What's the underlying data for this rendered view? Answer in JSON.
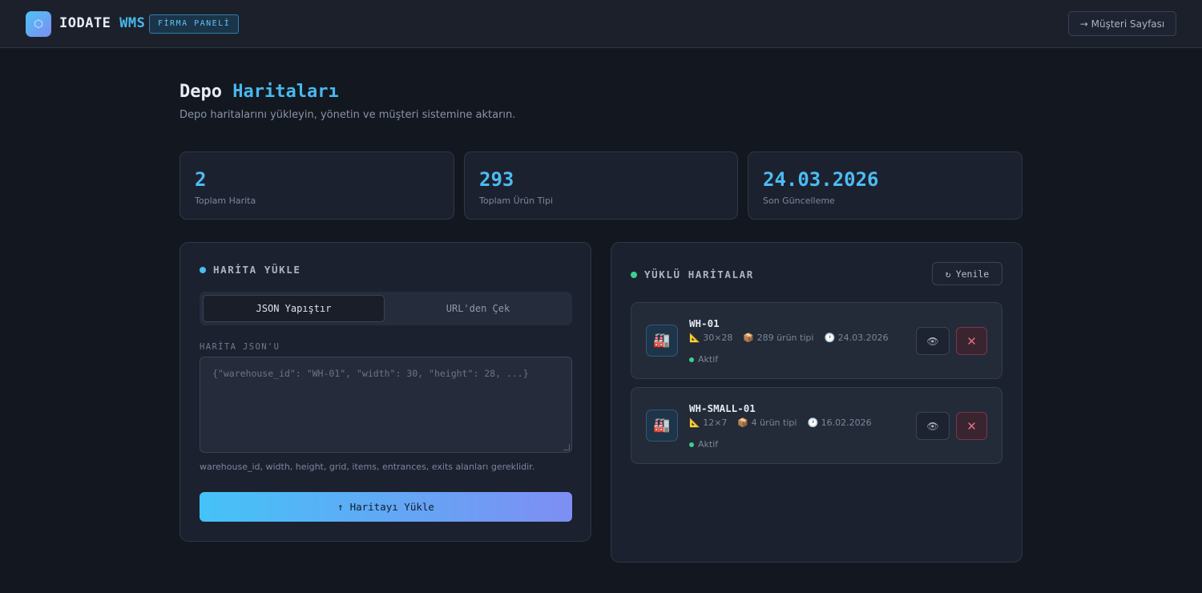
{
  "header": {
    "logo_icon": "hexagon-icon",
    "brand_main": "IODATE",
    "brand_accent": "WMS",
    "panel_badge": "FİRMA PANELİ",
    "customer_page": "→ Müşteri Sayfası"
  },
  "page": {
    "title_main": "Depo",
    "title_accent": "Haritaları",
    "subtitle": "Depo haritalarını yükleyin, yönetin ve müşteri sistemine aktarın."
  },
  "stats": [
    {
      "value": "2",
      "label": "Toplam Harita"
    },
    {
      "value": "293",
      "label": "Toplam Ürün Tipi"
    },
    {
      "value": "24.03.2026",
      "label": "Son Güncelleme"
    }
  ],
  "upload": {
    "heading": "HARİTA YÜKLE",
    "tabs": [
      {
        "label": "JSON Yapıştır"
      },
      {
        "label": "URL'den Çek"
      }
    ],
    "field_label": "HARİTA JSON'U",
    "placeholder": "{\"warehouse_id\": \"WH-01\", \"width\": 30, \"height\": 28, ...}",
    "hint": "warehouse_id, width, height, grid, items, entrances, exits alanları gereklidir.",
    "button_icon": "↑",
    "button_label": "Haritayı Yükle"
  },
  "loaded": {
    "heading": "YÜKLÜ HARİTALAR",
    "refresh_icon": "↻",
    "refresh_label": "Yenile",
    "maps": [
      {
        "name": "WH-01",
        "size": "📐 30×28",
        "items": "📦 289 ürün tipi",
        "date": "🕐 24.03.2026",
        "status": "Aktif"
      },
      {
        "name": "WH-SMALL-01",
        "size": "📐 12×7",
        "items": "📦 4 ürün tipi",
        "date": "🕐 16.02.2026",
        "status": "Aktif"
      }
    ],
    "map_icon": "🏭",
    "view_icon": "👁",
    "delete_icon": "✕"
  },
  "colors": {
    "accent": "#4cbcf2",
    "active": "#3ccf8e",
    "danger": "#e07082"
  }
}
